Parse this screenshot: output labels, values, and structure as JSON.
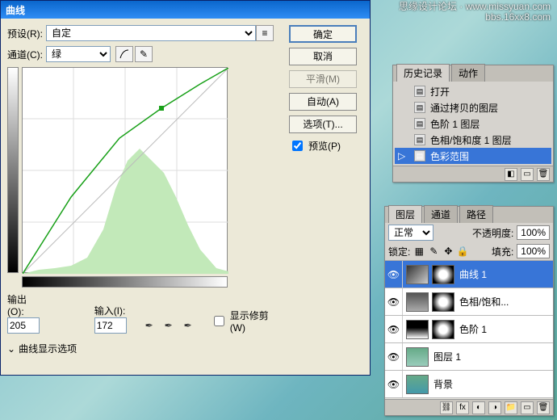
{
  "watermark": {
    "line1": "思缘设计论坛 · www.missyuan.com",
    "line2": "bbs.16xx8.com"
  },
  "dialog": {
    "title": "曲线",
    "preset_label": "预设(R):",
    "preset_value": "自定",
    "channel_label": "通道(C):",
    "channel_value": "绿",
    "output_label": "输出(O):",
    "output_value": "205",
    "input_label": "输入(I):",
    "input_value": "172",
    "show_clipping_label": "显示修剪(W)",
    "toggle_label": "曲线显示选项",
    "buttons": {
      "ok": "确定",
      "cancel": "取消",
      "smooth": "平滑(M)",
      "auto": "自动(A)",
      "options": "选项(T)...",
      "preview": "预览(P)"
    }
  },
  "chart_data": {
    "type": "curve",
    "channel": "green",
    "xlim": [
      0,
      255
    ],
    "ylim": [
      0,
      255
    ],
    "selected_point": {
      "input": 172,
      "output": 205
    },
    "curve_points": [
      {
        "x": 0,
        "y": 0
      },
      {
        "x": 60,
        "y": 95
      },
      {
        "x": 120,
        "y": 168
      },
      {
        "x": 172,
        "y": 205
      },
      {
        "x": 220,
        "y": 235
      },
      {
        "x": 255,
        "y": 255
      }
    ],
    "show_baseline": true,
    "show_histogram": true
  },
  "history": {
    "tab1": "历史记录",
    "tab2": "动作",
    "items": [
      {
        "label": "打开",
        "selected": false
      },
      {
        "label": "通过拷贝的图层",
        "selected": false
      },
      {
        "label": "色阶 1 图层",
        "selected": false
      },
      {
        "label": "色相/饱和度 1 图层",
        "selected": false
      },
      {
        "label": "色彩范围",
        "selected": true
      }
    ]
  },
  "layers": {
    "tab1": "图层",
    "tab2": "通道",
    "tab3": "路径",
    "blend_mode": "正常",
    "opacity_label": "不透明度:",
    "opacity_value": "100%",
    "lock_label": "锁定:",
    "fill_label": "填充:",
    "fill_value": "100%",
    "items": [
      {
        "name": "曲线 1",
        "selected": true,
        "has_mask": true,
        "thumb": "curves"
      },
      {
        "name": "色相/饱和...",
        "selected": false,
        "has_mask": true,
        "thumb": "hue"
      },
      {
        "name": "色阶 1",
        "selected": false,
        "has_mask": true,
        "thumb": "levels"
      },
      {
        "name": "图层 1",
        "selected": false,
        "has_mask": false,
        "thumb": "layer"
      },
      {
        "name": "背景",
        "selected": false,
        "has_mask": false,
        "thumb": "bg"
      }
    ]
  }
}
